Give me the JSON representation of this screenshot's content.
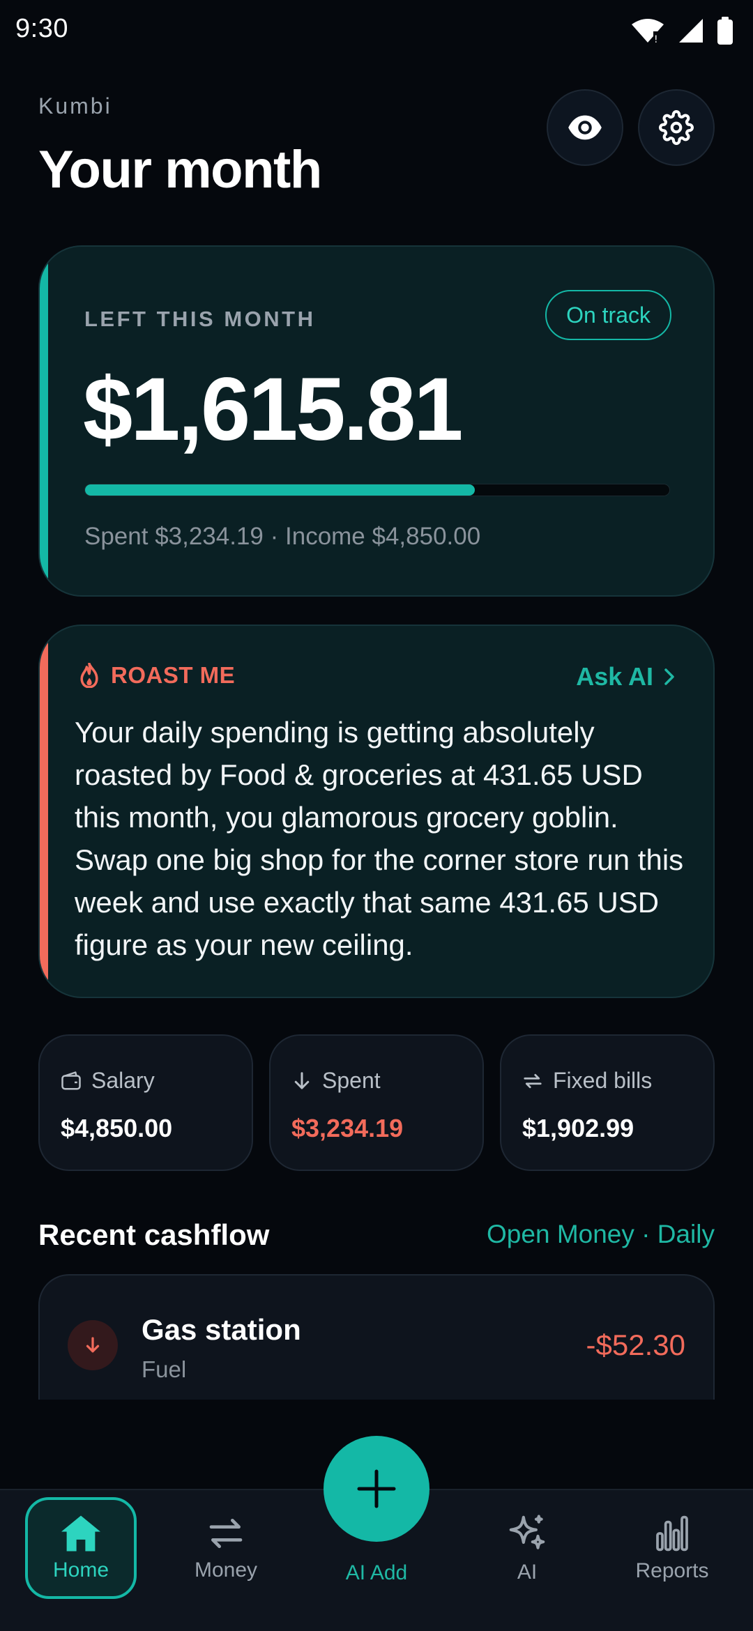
{
  "status_bar": {
    "time": "9:30"
  },
  "header": {
    "app_name": "Kumbi",
    "title": "Your month"
  },
  "balance": {
    "label": "LEFT THIS MONTH",
    "status": "On track",
    "amount": "$1,615.81",
    "progress_fraction": 0.667,
    "summary": "Spent $3,234.19 · Income $4,850.00",
    "accent_color": "#14b8a6"
  },
  "roast": {
    "label": "ROAST ME",
    "action": "Ask AI",
    "text": "Your daily spending is getting absolutely roasted by Food & groceries at 431.65 USD this month, you glamorous grocery goblin. Swap one big shop for the corner store run this week and use exactly that same 431.65 USD figure as your new ceiling.",
    "accent_color": "#f26b5b"
  },
  "stats": [
    {
      "label": "Salary",
      "value": "$4,850.00",
      "icon": "wallet-icon",
      "color": "#ffffff"
    },
    {
      "label": "Spent",
      "value": "$3,234.19",
      "icon": "arrow-down-icon",
      "color": "#f26b5b"
    },
    {
      "label": "Fixed bills",
      "value": "$1,902.99",
      "icon": "repeat-icon",
      "color": "#ffffff"
    }
  ],
  "cashflow": {
    "title": "Recent cashflow",
    "link": "Open Money · Daily",
    "transactions": [
      {
        "name": "Gas station",
        "category": "Fuel",
        "amount": "-$52.30"
      }
    ]
  },
  "nav": {
    "items": [
      {
        "label": "Home",
        "icon": "home-icon",
        "active": true
      },
      {
        "label": "Money",
        "icon": "transfer-icon",
        "active": false
      },
      {
        "label": "AI",
        "icon": "sparkle-icon",
        "active": false
      },
      {
        "label": "Reports",
        "icon": "bar-chart-icon",
        "active": false
      }
    ],
    "fab_label": "AI Add"
  }
}
